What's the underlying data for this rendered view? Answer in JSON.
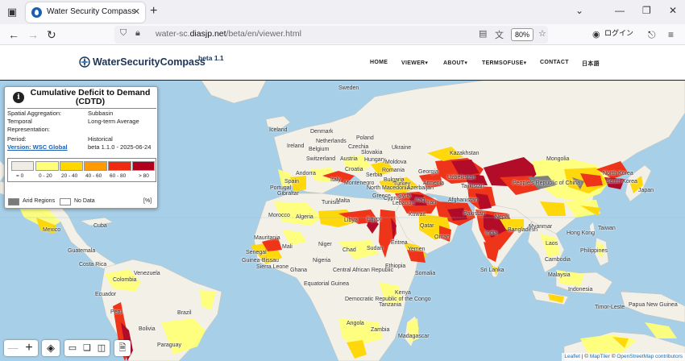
{
  "browser": {
    "tab_title": "Water Security Compass",
    "url_host": "water-sc.diasjp.net",
    "url_path": "/beta/en/viewer.html",
    "url_prefix": "water-sc.",
    "url_domain": "diasjp.net",
    "zoom": "80%",
    "login_label": "ログイン"
  },
  "site": {
    "logo_text": "WaterSecurityCompass",
    "logo_beta": "beta 1.1",
    "menu": {
      "home": "HOME",
      "viewer": "VIEWER",
      "about": "ABOUT",
      "termsofuse": "TERMSOFUSE",
      "contact": "CONTACT",
      "japanese": "日本語"
    }
  },
  "legend": {
    "title_line1": "Cumulative Deficit to Demand",
    "title_line2": "(CDTD)",
    "rows": {
      "spatial_label": "Spatial Aggregation:",
      "spatial_value": "Subbasin",
      "temporal_label1": "Temporal",
      "temporal_label2": "Representation:",
      "temporal_value": "Long-term Average",
      "period_label": "Period:",
      "period_value": "Historical",
      "version_label": "Version: WSC Global",
      "version_value": "beta 1.1.0 - 2025-06-24"
    },
    "scale": [
      {
        "label": "= 0",
        "color": "#f0ede6"
      },
      {
        "label": "0 - 20",
        "color": "#ffff7a"
      },
      {
        "label": "20 - 40",
        "color": "#ffd700"
      },
      {
        "label": "40 - 60",
        "color": "#ff9a00"
      },
      {
        "label": "60 - 80",
        "color": "#ee2b10"
      },
      {
        "label": "> 80",
        "color": "#b0001e"
      }
    ],
    "arid_label": "Arid Regions",
    "arid_color": "#7a7a7a",
    "nodata_label": "No Data",
    "nodata_color": "#ffffff",
    "unit": "[%]"
  },
  "places": {
    "iceland": "Iceland",
    "sweden": "Sweden",
    "ireland": "Ireland",
    "denmark": "Denmark",
    "netherlands": "Netherlands",
    "poland": "Poland",
    "belgium": "Belgium",
    "czechia": "Czechia",
    "slovakia": "Slovakia",
    "hungary": "Hungary",
    "switzerland": "Switzerland",
    "austria": "Austria",
    "ukraine": "Ukraine",
    "moldova": "Moldova",
    "italy": "Italy",
    "andorra": "Andorra",
    "croatia": "Croatia",
    "romania": "Romania",
    "serbia": "Serbia",
    "bulgaria": "Bulgaria",
    "montenegro": "Montenegro",
    "north_macedonia": "North Macedonia",
    "spain": "Spain",
    "portugal": "Portugal",
    "gibraltar": "Gibraltar",
    "greece": "Greece",
    "turkey": "Turkey",
    "georgia": "Georgia",
    "armenia": "Armenia",
    "azerbaijan": "Azerbaijan",
    "tunisia": "Tunisia",
    "malta": "Malta",
    "cyprus": "Cyprus",
    "syria": "Syria",
    "lebanon": "Lebanon",
    "iraq": "Iraq",
    "iran": "Iran",
    "morocco": "Morocco",
    "algeria": "Algeria",
    "libya": "Libya",
    "egypt": "Egypt",
    "kuwait": "Kuwait",
    "qatar": "Qatar",
    "oman": "Oman",
    "kazakhstan": "Kazakhstan",
    "uzbekistan": "Uzbekistan",
    "tajikistan": "Tajikistan",
    "afghanistan": "Afghanistan",
    "pakistan": "Pakistan",
    "mongolia": "Mongolia",
    "china": "People's Republic of China",
    "north_korea": "North Korea",
    "south_korea": "South Korea",
    "japan": "Japan",
    "nepal": "Nepal",
    "india": "India",
    "bangladesh": "Bangladesh",
    "myanmar": "Myanmar",
    "laos": "Laos",
    "hong_kong": "Hong Kong",
    "taiwan": "Taiwan",
    "philippines": "Philippines",
    "cambodia": "Cambodia",
    "sri_lanka": "Sri Lanka",
    "malaysia": "Malaysia",
    "indonesia": "Indonesia",
    "timor_leste": "Timor-Leste",
    "papua_new_guinea": "Papua New Guinea",
    "mauritania": "Mauritania",
    "mali": "Mali",
    "niger": "Niger",
    "chad": "Chad",
    "sudan": "Sudan",
    "eritrea": "Eritrea",
    "yemen": "Yemen",
    "senegal": "Senegal",
    "guinea_bissau": "Guinea-Bissau",
    "sierra_leone": "Sierra Leone",
    "ghana": "Ghana",
    "nigeria": "Nigeria",
    "car": "Central African Republic",
    "ethiopia": "Ethiopia",
    "somalia": "Somalia",
    "eq_guinea": "Equatorial Guinea",
    "drc": "Democratic Republic of the Congo",
    "kenya": "Kenya",
    "tanzania": "Tanzania",
    "angola": "Angola",
    "zambia": "Zambia",
    "madagascar": "Madagascar",
    "mexico": "Mexico",
    "cuba": "Cuba",
    "guatemala": "Guatemala",
    "costa_rica": "Costa Rica",
    "venezuela": "Venezuela",
    "colombia": "Colombia",
    "ecuador": "Ecuador",
    "peru": "Peru",
    "brazil": "Brazil",
    "bolivia": "Bolivia",
    "paraguay": "Paraguay"
  },
  "attribution": {
    "leaflet": "Leaflet",
    "sep1": "| ©",
    "maptiler": "MapTiler",
    "sep2": "©",
    "osm": "OpenStreetMap contributors"
  },
  "colors": {
    "ocean": "#a7cfe8",
    "land": "#f3f0e8",
    "header_text": "#1d3557",
    "link": "#1a5fb4"
  }
}
